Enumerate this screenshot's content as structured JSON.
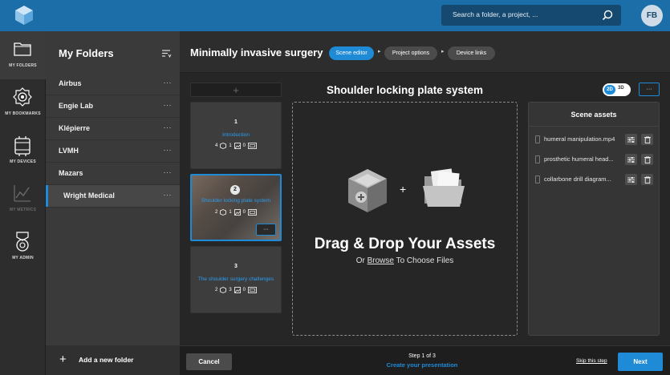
{
  "header": {
    "search_placeholder": "Search a folder, a project, ...",
    "avatar_initials": "FB",
    "colors": {
      "topbar": "#1b6ea8",
      "accent": "#1f8ad6"
    }
  },
  "nav": [
    {
      "label": "MY FOLDERS",
      "icon": "folder-icon",
      "active": true
    },
    {
      "label": "MY BOOKMARKS",
      "icon": "bookmark-badge-icon"
    },
    {
      "label": "MY DEVICES",
      "icon": "devices-icon"
    },
    {
      "label": "MY METRICS",
      "icon": "metrics-chart-icon",
      "disabled": true
    },
    {
      "label": "MY ADMIN",
      "icon": "admin-medal-icon"
    }
  ],
  "folders": {
    "title": "My Folders",
    "items": [
      {
        "name": "Airbus"
      },
      {
        "name": "Engie Lab"
      },
      {
        "name": "Klépierre"
      },
      {
        "name": "LVMH"
      },
      {
        "name": "Mazars"
      },
      {
        "name": "Wright Medical",
        "sub": true,
        "active": true
      }
    ],
    "dots": "···",
    "add_label": "Add a new folder"
  },
  "project": {
    "title": "Minimally invasive surgery",
    "steps": [
      {
        "label": "Scene editor",
        "active": true
      },
      {
        "label": "Project options"
      },
      {
        "label": "Device links"
      }
    ]
  },
  "slides": [
    {
      "number": "1",
      "title": "Introduction",
      "stats": [
        "4",
        "1",
        "0"
      ]
    },
    {
      "number": "2",
      "title": "Shoulder locking plate system",
      "stats": [
        "2",
        "1",
        "0"
      ],
      "selected": true,
      "more": "···"
    },
    {
      "number": "3",
      "title": "The shoulder surgery challenges",
      "stats": [
        "2",
        "3",
        "0"
      ]
    }
  ],
  "add_slide": "+",
  "scene": {
    "title": "Shoulder locking plate system",
    "toggle_2d": "2D",
    "toggle_3d": "3D",
    "more": "···",
    "dropzone_title": "Drag & Drop Your Assets",
    "dropzone_sub_pre": "Or ",
    "dropzone_sub_link": "Browse",
    "dropzone_sub_post": " To Choose Files",
    "plus": "+"
  },
  "assets": {
    "title": "Scene assets",
    "items": [
      {
        "name": "humeral manipulation.mp4"
      },
      {
        "name": "prosthetic humeral head..."
      },
      {
        "name": "collarbone drill diagram..."
      }
    ]
  },
  "footer": {
    "cancel": "Cancel",
    "step": "Step 1 of 3",
    "step_sub": "Create your presentation",
    "skip": "Skip this step",
    "next": "Next"
  }
}
